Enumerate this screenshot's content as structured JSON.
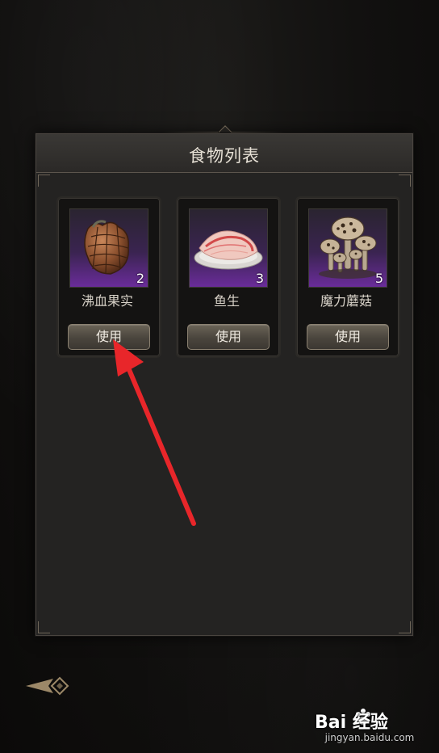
{
  "panel": {
    "title": "食物列表"
  },
  "items": [
    {
      "name": "沸血果实",
      "count": "2",
      "use_label": "使用",
      "icon": "pinecone-fruit-icon"
    },
    {
      "name": "鱼生",
      "count": "3",
      "use_label": "使用",
      "icon": "raw-fish-icon"
    },
    {
      "name": "魔力蘑菇",
      "count": "5",
      "use_label": "使用",
      "icon": "mushroom-cluster-icon"
    }
  ],
  "navigation": {
    "back_icon": "back-arrow-icon"
  },
  "watermark": {
    "brand": "Bai 经验",
    "url": "jingyan.baidu.com"
  },
  "colors": {
    "panel_bg": "#242322",
    "card_bg": "#141312",
    "item_frame_purple": "#6a2c9a",
    "button_bg": "#4a453d",
    "annotation_arrow": "#e8262a"
  }
}
